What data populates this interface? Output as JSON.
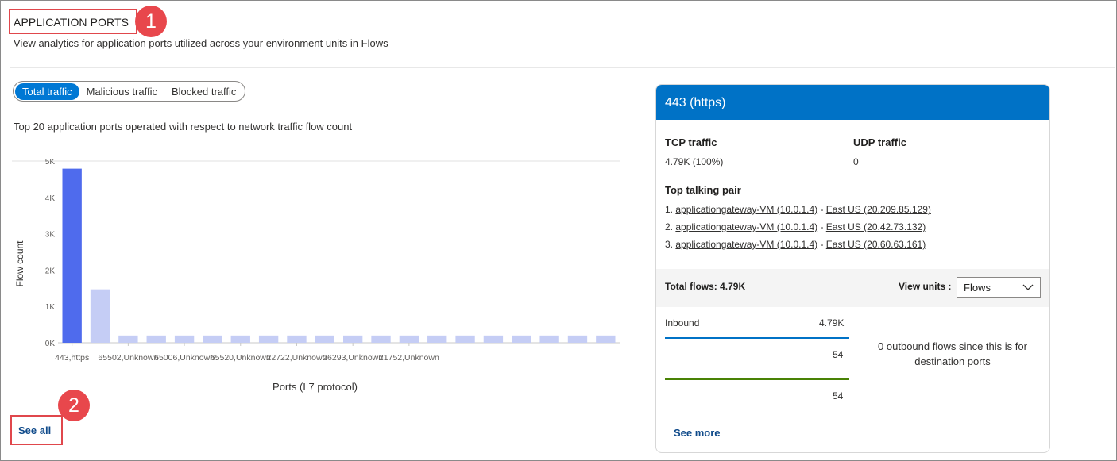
{
  "section": {
    "title": "APPLICATION PORTS",
    "subtitle_prefix": "View analytics for application ports utilized across your environment units in ",
    "subtitle_link": "Flows"
  },
  "callouts": [
    "1",
    "2"
  ],
  "tabs": [
    {
      "label": "Total traffic",
      "active": true
    },
    {
      "label": "Malicious traffic",
      "active": false
    },
    {
      "label": "Blocked traffic",
      "active": false
    }
  ],
  "chart_description": "Top 20 application ports operated with respect to network traffic flow count",
  "chart_data": {
    "type": "bar",
    "xlabel": "Ports (L7 protocol)",
    "ylabel": "Flow count",
    "ylim": [
      0,
      5000
    ],
    "yticks": [
      {
        "value": 0,
        "label": "0K"
      },
      {
        "value": 1000,
        "label": "1K"
      },
      {
        "value": 2000,
        "label": "2K"
      },
      {
        "value": 3000,
        "label": "3K"
      },
      {
        "value": 4000,
        "label": "4K"
      },
      {
        "value": 5000,
        "label": "5K"
      }
    ],
    "categories_visible": [
      "443,https",
      "",
      "65502,Unknown",
      "",
      "65006,Unknown",
      "",
      "65520,Unknown",
      "",
      "22722,Unknown",
      "",
      "26293,Unknown",
      "",
      "21752,Unknown",
      "",
      "",
      "",
      "",
      "",
      "",
      ""
    ],
    "values": [
      4790,
      1470,
      200,
      200,
      200,
      200,
      200,
      200,
      200,
      200,
      200,
      200,
      200,
      200,
      200,
      200,
      200,
      200,
      200,
      200
    ],
    "selected_index": 0,
    "colors": {
      "selected": "#4f6bed",
      "other": "#c5cdf5"
    }
  },
  "see_all": "See all",
  "detail": {
    "header": "443 (https)",
    "tcp_label": "TCP traffic",
    "tcp_value": "4.79K (100%)",
    "udp_label": "UDP traffic",
    "udp_value": "0",
    "top_pair_label": "Top talking pair",
    "pairs": [
      {
        "num": "1.",
        "src": "applicationgateway-VM (10.0.1.4)",
        "sep": " - ",
        "dst": "East US (20.209.85.129)"
      },
      {
        "num": "2.",
        "src": "applicationgateway-VM (10.0.1.4)",
        "sep": " - ",
        "dst": "East US (20.42.73.132)"
      },
      {
        "num": "3.",
        "src": "applicationgateway-VM (10.0.1.4)",
        "sep": " - ",
        "dst": "East US (20.60.63.161)"
      }
    ],
    "total_flows": "Total flows: 4.79K",
    "view_units_label": "View units :",
    "view_units_value": "Flows",
    "inbound_label": "Inbound",
    "inbound_value": "4.79K",
    "value_a": "54",
    "value_b": "54",
    "outbound_note": "0 outbound flows since this is for destination ports",
    "see_more": "See more",
    "colors": {
      "header": "#0072c6",
      "inbound_line": "#0072c6",
      "outbound_line": "#498205"
    }
  }
}
